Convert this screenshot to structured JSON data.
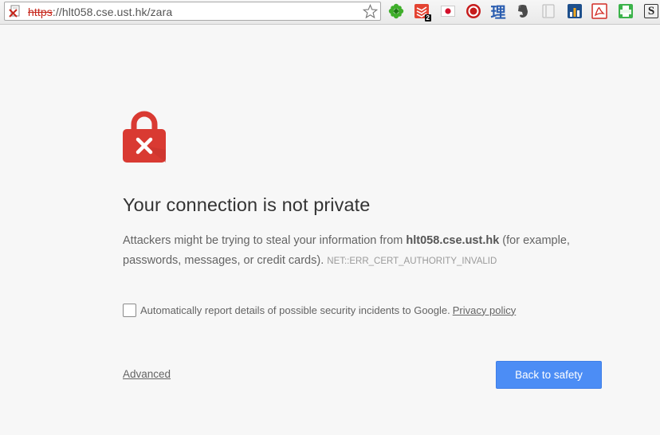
{
  "address_bar": {
    "scheme": "https",
    "rest": "://hlt058.cse.ust.hk/zara",
    "security_state": "not-secure",
    "scheme_color": "#c6261b"
  },
  "extensions": [
    {
      "name": "green-flower-extension-icon"
    },
    {
      "name": "todoist-extension-icon",
      "badge": "2"
    },
    {
      "name": "japan-flag-extension-icon"
    },
    {
      "name": "stop-extension-icon"
    },
    {
      "name": "kanji-extension-icon",
      "glyph": "理"
    },
    {
      "name": "evernote-extension-icon"
    },
    {
      "name": "gray-page-extension-icon"
    },
    {
      "name": "stats-chart-extension-icon"
    },
    {
      "name": "pdf-extension-icon"
    },
    {
      "name": "print-extension-icon"
    },
    {
      "name": "s-letter-extension-icon",
      "glyph": "S"
    }
  ],
  "interstitial": {
    "heading": "Your connection is not private",
    "explanation_before": "Attackers might be trying to steal your information from ",
    "host": "hlt058.cse.ust.hk",
    "explanation_after": " (for example, passwords, messages, or credit cards).",
    "error_code": "NET::ERR_CERT_AUTHORITY_INVALID",
    "report_checkbox_label": "Automatically report details of possible security incidents to Google.",
    "report_checked": false,
    "privacy_link": "Privacy policy",
    "advanced_link": "Advanced",
    "primary_button": "Back to safety",
    "accent_color": "#4c8df5",
    "lock_color": "#d93a32"
  }
}
